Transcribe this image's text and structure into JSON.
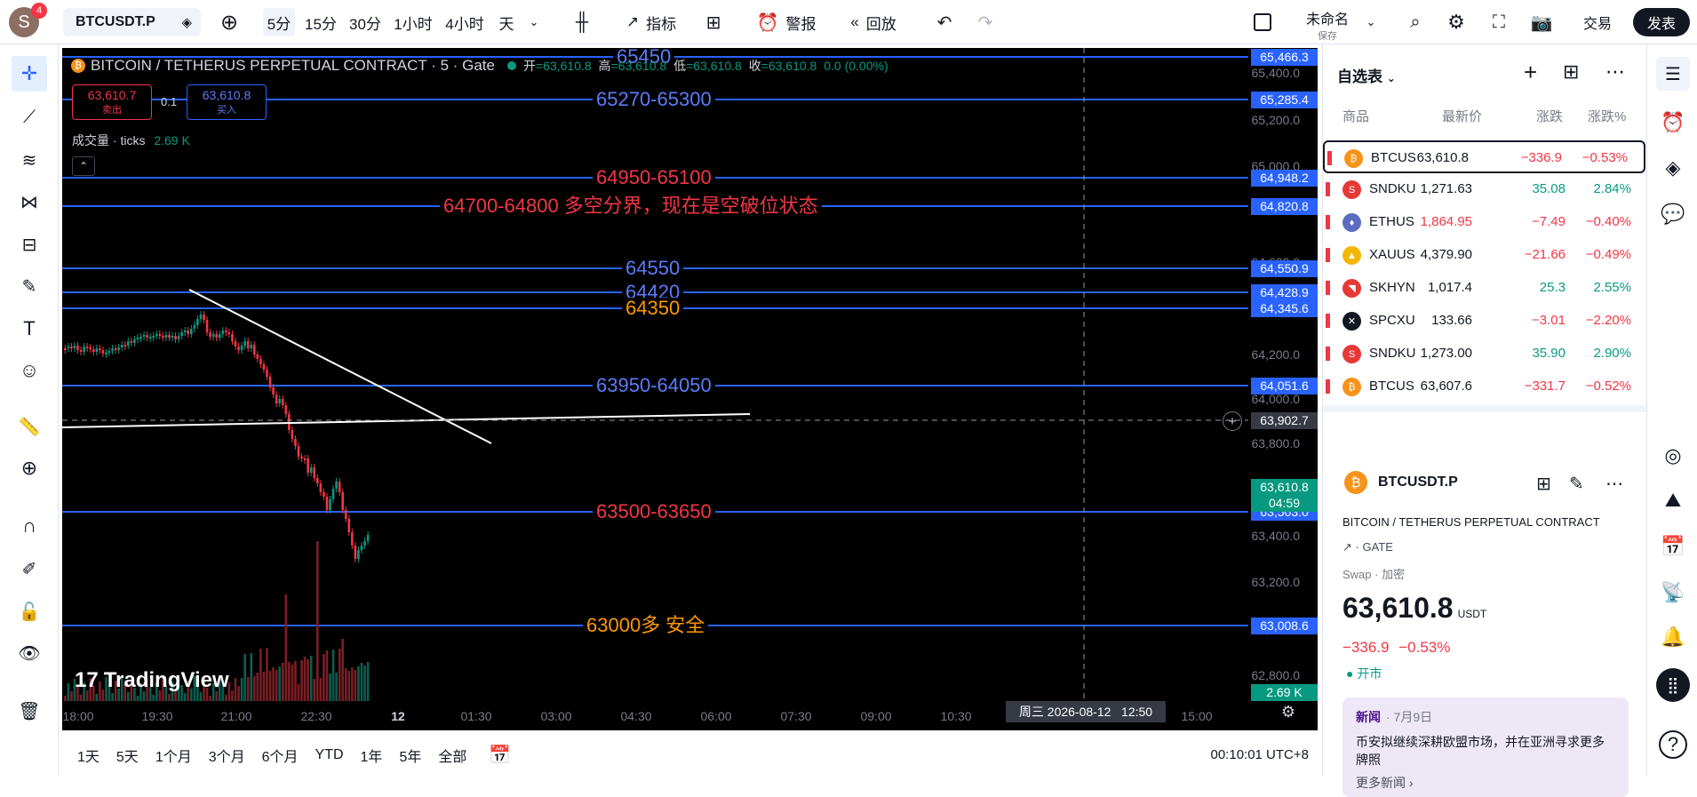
{
  "colors": {
    "up": "#089981",
    "down": "#f23645",
    "blue_line": "#2962ff",
    "red_text": "#f23645",
    "orange_text": "#ff9800",
    "blue_text": "#5b7cfa"
  },
  "topbar": {
    "avatar_letter": "S",
    "avatar_badge": "4",
    "symbol": "BTCUSDT.P",
    "intervals": [
      "5分",
      "15分",
      "30分",
      "1小时",
      "4小时",
      "天"
    ],
    "indicators_label": "指标",
    "alert_label": "警报",
    "replay_label": "回放",
    "layout_name": "未命名",
    "layout_saved": "保存",
    "trade_label": "交易",
    "publish_label": "发表"
  },
  "chart": {
    "title": "BITCOIN / TETHERUS PERPETUAL CONTRACT · 5 · Gate",
    "ohlc": {
      "o_label": "开",
      "o": "=63,610.8",
      "h_label": "高",
      "h": "=63,610.8",
      "l_label": "低",
      "l": "=63,610.8",
      "c_label": "收",
      "c": "=63,610.8",
      "chg": "0.0 (0.00%)"
    },
    "sell_price": "63,610.7",
    "sell_label": "卖出",
    "spread": "0.1",
    "buy_price": "63,610.8",
    "buy_label": "买入",
    "volume_label": "成交量 · ticks",
    "volume_value": "2.69 K",
    "levels": [
      {
        "text": "65450",
        "color": "#5b7cfa",
        "tag": "65,466.3"
      },
      {
        "text": "65270-65300",
        "color": "#5b7cfa",
        "tag": "65,285.4"
      },
      {
        "text": "64950-65100",
        "color": "#f23645",
        "tag": "64,948.2"
      },
      {
        "text": "64700-64800  多空分界，现在是空破位状态",
        "color": "#f23645",
        "tag": "64,820.8"
      },
      {
        "text": "64550",
        "color": "#5b7cfa",
        "tag": "64,550.9"
      },
      {
        "text": "64420",
        "color": "#5b7cfa",
        "tag": "64,428.9"
      },
      {
        "text": "64350",
        "color": "#ff9800",
        "tag": "64,345.6"
      },
      {
        "text": "63950-64050",
        "color": "#5b7cfa",
        "tag": "64,051.6"
      },
      {
        "text": "63500-63650",
        "color": "#f23645",
        "tag": "63,503.0"
      },
      {
        "text": "63000多  安全",
        "color": "#ff9800",
        "tag": "63,008.6"
      }
    ],
    "price_axis": [
      "65,400.0",
      "65,200.0",
      "65,000.0",
      "64,800.0",
      "64,600.0",
      "64,400.0",
      "64,200.0",
      "64,000.0",
      "63,800.0",
      "63,400.0",
      "63,200.0",
      "63,000.0",
      "62,800.0"
    ],
    "crosshair_price": "63,902.7",
    "last_price": "63,610.8",
    "countdown": "04:59",
    "vol_tag": "2.69 K",
    "time_axis": [
      "18:00",
      "19:30",
      "21:00",
      "22:30",
      "12",
      "01:30",
      "03:00",
      "04:30",
      "06:00",
      "07:30",
      "09:00",
      "10:30",
      "15:00"
    ],
    "crosshair_time": "周三 2026-08-12   12:50",
    "watermark": "TradingView"
  },
  "bottombar": {
    "ranges": [
      "1天",
      "5天",
      "1个月",
      "3个月",
      "6个月",
      "YTD",
      "1年",
      "5年",
      "全部"
    ],
    "clock": "00:10:01 UTC+8"
  },
  "watchlist": {
    "title": "自选表",
    "headers": [
      "商品",
      "最新价",
      "涨跌",
      "涨跌%"
    ],
    "rows": [
      {
        "sym": "BTCUS",
        "price": "63,610.8",
        "chg": "−336.9",
        "pct": "−0.53%",
        "dir": "down",
        "icon": "bitcoin-icon",
        "ic": "#f7931a",
        "g": "₿"
      },
      {
        "sym": "SNDKU",
        "price": "1,271.63",
        "chg": "35.08",
        "pct": "2.84%",
        "dir": "up",
        "icon": "sandisk-icon",
        "ic": "#e53935",
        "g": "S"
      },
      {
        "sym": "ETHUS",
        "price": "1,864.95",
        "chg": "−7.49",
        "pct": "−0.40%",
        "dir": "down",
        "icon": "ethereum-icon",
        "ic": "#5c6bc0",
        "g": "♦"
      },
      {
        "sym": "XAUUS",
        "price": "4,379.90",
        "chg": "−21.66",
        "pct": "−0.49%",
        "dir": "down",
        "icon": "gold-icon",
        "ic": "#f2b705",
        "g": "▲"
      },
      {
        "sym": "SKHYN",
        "price": "1,017.4",
        "chg": "25.3",
        "pct": "2.55%",
        "dir": "up",
        "icon": "skhynix-icon",
        "ic": "#e53935",
        "g": "◥"
      },
      {
        "sym": "SPCXU",
        "price": "133.66",
        "chg": "−3.01",
        "pct": "−2.20%",
        "dir": "down",
        "icon": "spacex-icon",
        "ic": "#131722",
        "g": "✕"
      },
      {
        "sym": "SNDKU",
        "price": "1,273.00",
        "chg": "35.90",
        "pct": "2.90%",
        "dir": "up",
        "icon": "sandisk-icon",
        "ic": "#e53935",
        "g": "S"
      },
      {
        "sym": "BTCUS",
        "price": "63,607.6",
        "chg": "−331.7",
        "pct": "−0.52%",
        "dir": "down",
        "icon": "bitcoin-icon",
        "ic": "#f7931a",
        "g": "₿"
      }
    ]
  },
  "details": {
    "symbol": "BTCUSDT.P",
    "fullname": "BITCOIN / TETHERUS PERPETUAL CONTRACT",
    "exchange": "GATE",
    "type": "Swap · 加密",
    "price": "63,610.8",
    "currency": "USDT",
    "change": "−336.9",
    "change_pct": "−0.53%",
    "status": "开市",
    "news_tag": "新闻",
    "news_date": "· 7月9日",
    "news_text": "币安拟继续深耕欧盟市场，并在亚洲寻求更多牌照",
    "news_more": "更多新闻 ›"
  }
}
